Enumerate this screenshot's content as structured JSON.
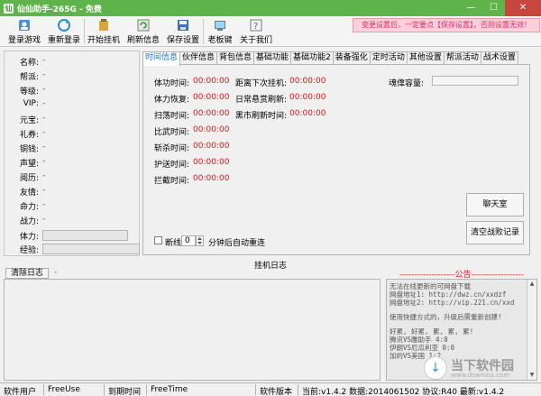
{
  "window": {
    "icon_text": "仙",
    "title": "仙仙助手-265G - 免费",
    "btn_min": "—",
    "btn_max": "☐",
    "btn_close": "✕"
  },
  "toolbar": {
    "items": [
      {
        "label": "登录游戏",
        "icon": "login-icon"
      },
      {
        "label": "重新登录",
        "icon": "relogin-icon"
      },
      {
        "label": "开始挂机",
        "icon": "start-icon"
      },
      {
        "label": "刷新信息",
        "icon": "refresh-icon"
      },
      {
        "label": "保存设置",
        "icon": "save-icon"
      },
      {
        "label": "老板键",
        "icon": "boss-key-icon"
      },
      {
        "label": "关于我们",
        "icon": "about-icon"
      }
    ],
    "warning": "变更设置后，一定要点【保存设置】，否则设置无效！"
  },
  "character": {
    "rows": [
      {
        "label": "名称:",
        "value": "-"
      },
      {
        "label": "帮派:",
        "value": "-"
      },
      {
        "label": "等级:",
        "value": "-"
      },
      {
        "label": "VIP:",
        "value": "-"
      },
      {
        "label": "元宝:",
        "value": "-"
      },
      {
        "label": "礼券:",
        "value": "-"
      },
      {
        "label": "铜钱:",
        "value": "-"
      },
      {
        "label": "声望:",
        "value": "-"
      },
      {
        "label": "阅历:",
        "value": "-"
      },
      {
        "label": "友情:",
        "value": "-"
      },
      {
        "label": "命力:",
        "value": "-"
      },
      {
        "label": "战力:",
        "value": "-"
      }
    ],
    "stamina_label": "体力:",
    "stamina_fraction": 0.0,
    "exp_label": "经验:",
    "exp_fraction": 0.0
  },
  "tabs": [
    "时间信息",
    "伙伴信息",
    "背包信息",
    "基础功能",
    "基础功能2",
    "装备强化",
    "定时活动",
    "其他设置",
    "帮派活动",
    "战术设置"
  ],
  "active_tab": 0,
  "time_info": {
    "left": [
      {
        "label": "体功时间:",
        "value": "00:00:00"
      },
      {
        "label": "体力恢复:",
        "value": "00:00:00"
      },
      {
        "label": "扫荡时间:",
        "value": "00:00:00"
      },
      {
        "label": "比武时间:",
        "value": "00:00:00"
      },
      {
        "label": "斩杀时间:",
        "value": "00:00:00"
      },
      {
        "label": "护送时间:",
        "value": "00:00:00"
      },
      {
        "label": "拦截时间:",
        "value": "00:00:00"
      }
    ],
    "middle": [
      {
        "label": "距离下次挂机:",
        "value": "00:00:00"
      },
      {
        "label": "日常悬赏刷新:",
        "value": "00:00:00"
      },
      {
        "label": "黑市刷新时间:",
        "value": "00:00:00"
      }
    ],
    "soul_capacity_label": "魂偉容量:",
    "disconnect_label": "断线",
    "reconnect_minutes": "0",
    "reconnect_suffix": "分钟后自动重连",
    "chat_button": "聊天室",
    "clear_battle_button": "清空战败记录"
  },
  "log": {
    "section_title": "挂机日志",
    "clear_button": "清除日志",
    "dash": "-"
  },
  "announcement": {
    "title": "-------------------公告------------------",
    "lines": [
      "无法在线更新的可网盘下载",
      "网盘地址1: http://dwz.cn/xxdzf",
      "网盘地址2: http://vip.221.cn/xxd",
      "",
      "使用快捷方式的，升级后需重新创建!",
      "",
      "好累, 好累, 累, 累, 累!",
      "腾讯VS雕助手 4:0",
      "伊朗VS厄瓜利亚 0:0",
      "加的VS美国 1:2"
    ]
  },
  "status": {
    "user_label": "软件用户",
    "user_value": "FreeUse",
    "expire_label": "到期时间",
    "expire_value": "FreeTime",
    "version_label": "软件版本",
    "version_info": "当前:v1.4.2  数据:2014061502  协议:R40  最新:v1.4.2"
  },
  "watermark": {
    "text": "当下软件园",
    "sub": "www.downxia.com",
    "glyph": "↓"
  }
}
